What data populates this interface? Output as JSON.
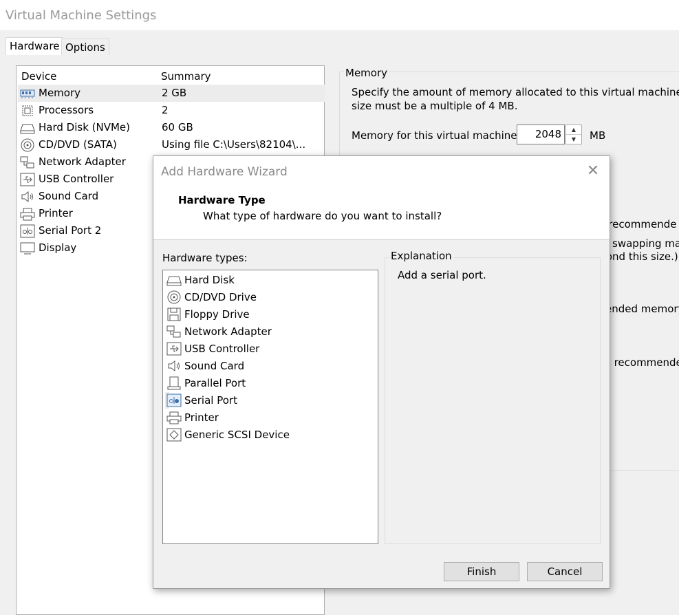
{
  "window": {
    "title": "Virtual Machine Settings"
  },
  "tabs": [
    {
      "label": "Hardware"
    },
    {
      "label": "Options"
    }
  ],
  "device_list": {
    "headers": {
      "device": "Device",
      "summary": "Summary"
    },
    "rows": [
      {
        "name": "Memory",
        "summary": "2 GB",
        "icon": "memory-icon"
      },
      {
        "name": "Processors",
        "summary": "2",
        "icon": "processor-icon"
      },
      {
        "name": "Hard Disk (NVMe)",
        "summary": "60 GB",
        "icon": "hard-disk-icon"
      },
      {
        "name": "CD/DVD (SATA)",
        "summary": "Using file C:\\Users\\82104\\...",
        "icon": "cd-dvd-icon"
      },
      {
        "name": "Network Adapter",
        "summary": "",
        "icon": "network-adapter-icon"
      },
      {
        "name": "USB Controller",
        "summary": "",
        "icon": "usb-controller-icon"
      },
      {
        "name": "Sound Card",
        "summary": "",
        "icon": "sound-card-icon"
      },
      {
        "name": "Printer",
        "summary": "",
        "icon": "printer-icon"
      },
      {
        "name": "Serial Port 2",
        "summary": "",
        "icon": "serial-port-icon"
      },
      {
        "name": "Display",
        "summary": "",
        "icon": "display-icon"
      }
    ]
  },
  "memory_panel": {
    "legend": "Memory",
    "desc_line1": "Specify the amount of memory allocated to this virtual machine. Th",
    "desc_line2": "size must be a multiple of 4 MB.",
    "field_label": "Memory for this virtual machine:",
    "value": "2048",
    "unit": "MB",
    "hidden_fragments": [
      "n recommende",
      "swapping may",
      "yond this size.)",
      "ended memory",
      "s recommende"
    ]
  },
  "wizard": {
    "title": "Add Hardware Wizard",
    "heading": "Hardware Type",
    "subheading": "What type of hardware do you want to install?",
    "list_label": "Hardware types:",
    "items": [
      {
        "label": "Hard Disk",
        "icon": "hard-disk-icon"
      },
      {
        "label": "CD/DVD Drive",
        "icon": "cd-dvd-icon"
      },
      {
        "label": "Floppy Drive",
        "icon": "floppy-icon"
      },
      {
        "label": "Network Adapter",
        "icon": "network-adapter-icon"
      },
      {
        "label": "USB Controller",
        "icon": "usb-controller-icon"
      },
      {
        "label": "Sound Card",
        "icon": "sound-card-icon"
      },
      {
        "label": "Parallel Port",
        "icon": "parallel-port-icon"
      },
      {
        "label": "Serial Port",
        "icon": "serial-port-icon"
      },
      {
        "label": "Printer",
        "icon": "printer-icon"
      },
      {
        "label": "Generic SCSI Device",
        "icon": "scsi-device-icon"
      }
    ],
    "selected_item": "Serial Port",
    "explanation_label": "Explanation",
    "explanation_text": "Add a serial port.",
    "finish_label": "Finish",
    "cancel_label": "Cancel"
  }
}
